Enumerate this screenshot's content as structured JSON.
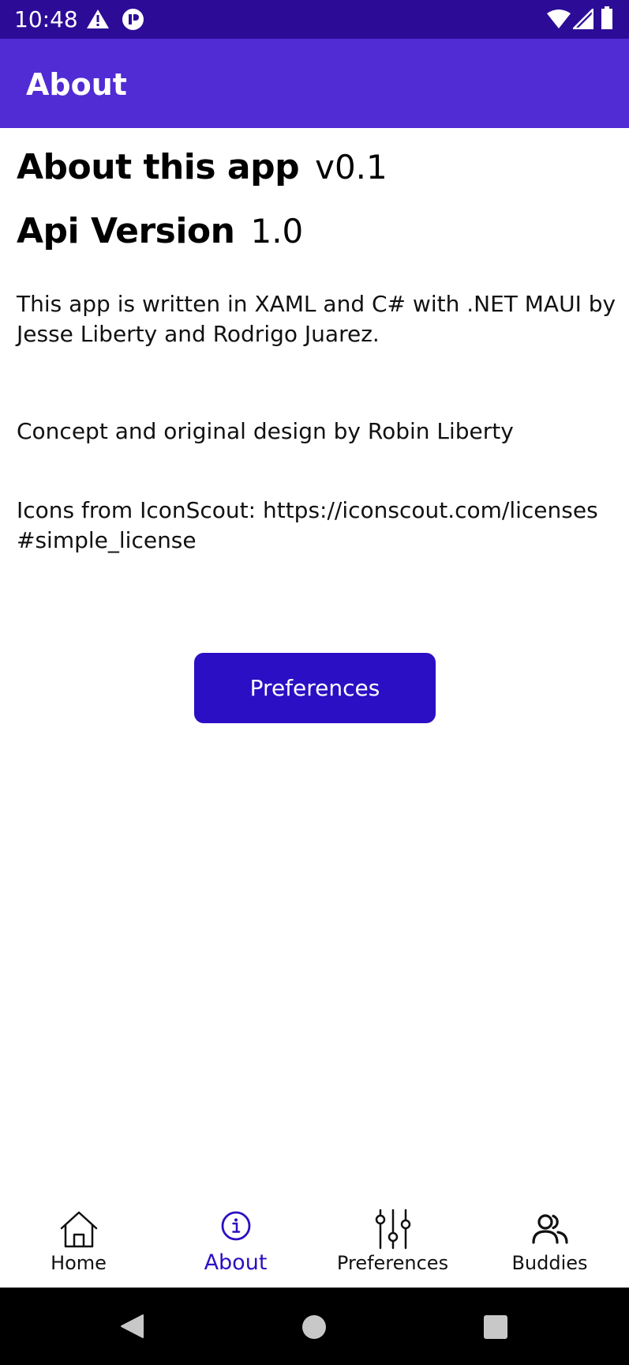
{
  "status_bar": {
    "time": "10:48",
    "icons": [
      "warning-icon",
      "privacy-indicator-icon",
      "wifi-icon",
      "cell-signal-icon",
      "battery-icon"
    ]
  },
  "app_bar": {
    "title": "About"
  },
  "content": {
    "about_label": "About this app",
    "app_version": "v0.1",
    "api_label": "Api Version",
    "api_version": "1.0",
    "description": "This app is written in XAML and C# with .NET MAUI by Jesse Liberty and Rodrigo Juarez.",
    "credit": "Concept and original design by Robin Liberty",
    "icons_credit_line1": "Icons from IconScout: https://iconscout.com/licenses",
    "icons_credit_line2": "#simple_license",
    "preferences_button": "Preferences"
  },
  "tabs": [
    {
      "label": "Home",
      "icon": "home-icon",
      "active": false
    },
    {
      "label": "About",
      "icon": "info-icon",
      "active": true
    },
    {
      "label": "Preferences",
      "icon": "sliders-icon",
      "active": false
    },
    {
      "label": "Buddies",
      "icon": "people-icon",
      "active": false
    }
  ],
  "nav_bar": {
    "buttons": [
      "back-icon",
      "home-circle-icon",
      "recents-icon"
    ]
  },
  "colors": {
    "status_bar": "#2c0c97",
    "app_bar": "#512bd4",
    "accent": "#2b0fc4",
    "nav_bar": "#000000"
  }
}
